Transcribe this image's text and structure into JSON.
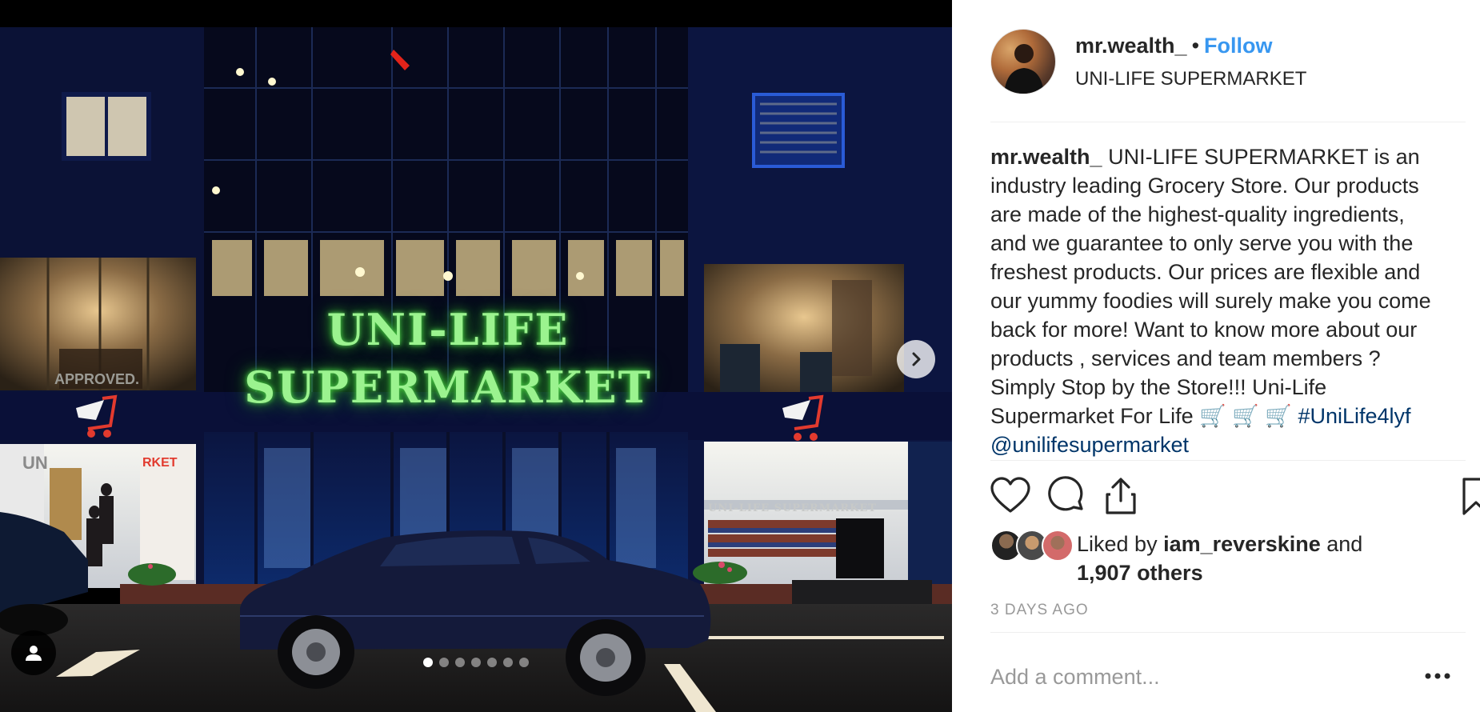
{
  "photo": {
    "sign_line1": "UNI-LIFE",
    "sign_line2": "SUPERMARKET",
    "shop_banner": "UNI-LIFE SUPERMARKET",
    "approved_text": "APPROVED.",
    "left_banner_partial": "UN",
    "right_banner_partial": "RKET",
    "carousel_total": 7,
    "carousel_active": 1
  },
  "post": {
    "username": "mr.wealth_",
    "separator": "•",
    "follow_label": "Follow",
    "location": "UNI-LIFE SUPERMARKET",
    "caption_username": "mr.wealth_",
    "caption_text": "UNI-LIFE SUPERMARKET is an industry leading Grocery Store. Our products are made of the highest-quality ingredients, and we guarantee to only serve you with the freshest products. Our prices are flexible and our yummy foodies will surely make you come back for more! Want to know more about our products , services and team members ? Simply Stop by the Store!!! Uni-Life Supermarket For Life 🛒 🛒 🛒",
    "hashtag": "#UniLife4lyf",
    "mention": "@unilifesupermarket",
    "liked_by_prefix": "Liked by",
    "liked_by_user": "iam_reverskine",
    "liked_by_and": "and",
    "likes_others": "1,907 others",
    "time_ago": "3 DAYS AGO",
    "comment_placeholder": "Add a comment..."
  },
  "icons": {
    "like": "heart-icon",
    "comment": "comment-bubble-icon",
    "share": "share-upload-icon",
    "save": "bookmark-icon",
    "more": "more-dots-icon",
    "next": "chevron-right-icon",
    "tags": "user-tag-icon"
  },
  "colors": {
    "follow": "#3897f0",
    "hashtag": "#003569",
    "muted": "#999999",
    "text": "#262626",
    "sign_glow": "#9bf38f"
  }
}
